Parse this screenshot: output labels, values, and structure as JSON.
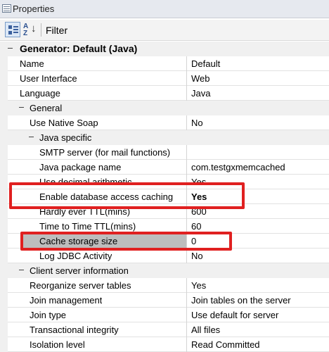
{
  "window": {
    "title": "Properties"
  },
  "toolbar": {
    "filter_label": "Filter"
  },
  "grid": {
    "group_title": "Generator: Default (Java)",
    "rows": [
      {
        "label": "Name",
        "value": "Default"
      },
      {
        "label": "User Interface",
        "value": "Web"
      },
      {
        "label": "Language",
        "value": "Java"
      }
    ],
    "general": {
      "title": "General",
      "rows": [
        {
          "label": "Use Native Soap",
          "value": "No"
        }
      ],
      "java_specific": {
        "title": "Java specific",
        "rows": [
          {
            "label": "SMTP server (for mail functions)",
            "value": ""
          },
          {
            "label": "Java package name",
            "value": "com.testgxmemcached"
          },
          {
            "label": "Use decimal arithmetic",
            "value": "Yes"
          },
          {
            "label": "Enable database access caching",
            "value": "Yes"
          },
          {
            "label": "Hardly ever TTL(mins)",
            "value": "600"
          },
          {
            "label": "Time to Time TTL(mins)",
            "value": "60"
          },
          {
            "label": "Cache storage size",
            "value": "0"
          },
          {
            "label": "Log JDBC Activity",
            "value": "No"
          }
        ]
      }
    },
    "client_server": {
      "title": "Client server information",
      "rows": [
        {
          "label": "Reorganize server tables",
          "value": "Yes"
        },
        {
          "label": "Join management",
          "value": "Join tables on the server"
        },
        {
          "label": "Join type",
          "value": "Use default for server"
        },
        {
          "label": "Transactional integrity",
          "value": "All files"
        },
        {
          "label": "Isolation level",
          "value": "Read Committed"
        }
      ]
    }
  },
  "highlight_color": "#e02020"
}
